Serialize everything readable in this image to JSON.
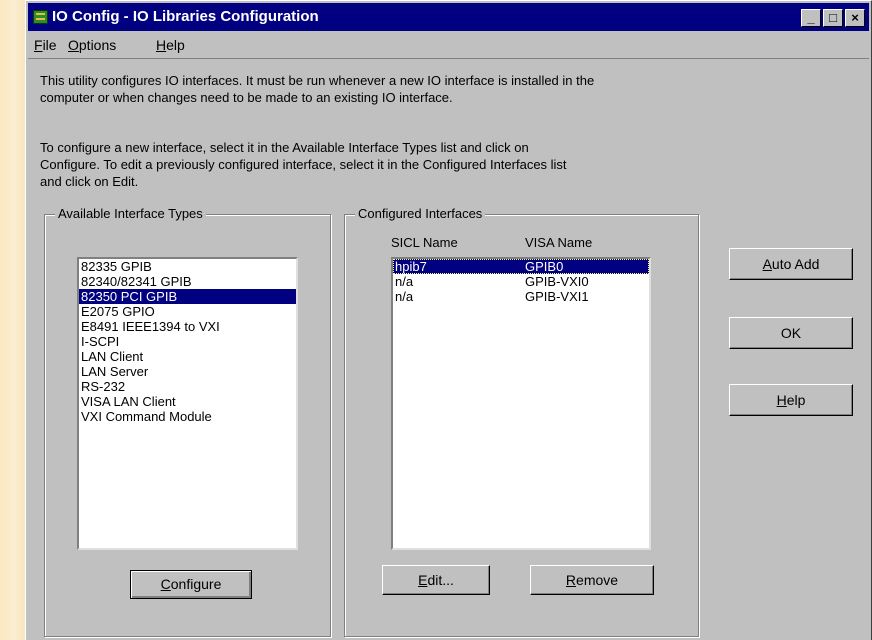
{
  "window": {
    "title": "IO Config - IO Libraries Configuration",
    "controls": {
      "minimize": "_",
      "maximize": "□",
      "close": "×"
    }
  },
  "menu": [
    {
      "key": "F",
      "rest": "ile"
    },
    {
      "key": "O",
      "rest": "ptions"
    },
    {
      "key": "H",
      "rest": "elp"
    }
  ],
  "intro": {
    "line1": "This utility configures IO interfaces.  It must be run whenever a new IO interface is installed in the",
    "line2": "computer or when changes need to be made to an existing IO interface."
  },
  "instructions": {
    "line1": "To configure a new interface, select it in the Available Interface Types list and click on",
    "line2": "Configure.  To edit a previously configured interface, select it in the Configured Interfaces list",
    "line3": "and click on Edit."
  },
  "available": {
    "label": "Available Interface Types",
    "items": [
      "82335 GPIB",
      "82340/82341 GPIB",
      "82350 PCI GPIB",
      "E2075 GPIO",
      "E8491 IEEE1394 to VXI",
      "I-SCPI",
      "LAN Client",
      "LAN Server",
      "RS-232",
      "VISA LAN Client",
      "VXI Command Module"
    ],
    "selected_index": 2,
    "configure_button": {
      "key": "C",
      "rest": "onfigure"
    }
  },
  "configured": {
    "label": "Configured Interfaces",
    "headers": {
      "sicl": "SICL Name",
      "visa": "VISA Name"
    },
    "rows": [
      {
        "sicl": "hpib7",
        "visa": "GPIB0"
      },
      {
        "sicl": "n/a",
        "visa": "GPIB-VXI0"
      },
      {
        "sicl": "n/a",
        "visa": "GPIB-VXI1"
      }
    ],
    "selected_index": 0,
    "edit_button": {
      "key": "E",
      "rest": "dit..."
    },
    "remove_button": {
      "key": "R",
      "rest": "emove"
    }
  },
  "side_buttons": {
    "auto_add": {
      "key": "A",
      "rest": "uto Add"
    },
    "ok": "OK",
    "help": {
      "key": "H",
      "rest": "elp"
    }
  },
  "colors": {
    "titlebar": "#000080",
    "selection": "#000080",
    "face": "#c0c0c0"
  }
}
